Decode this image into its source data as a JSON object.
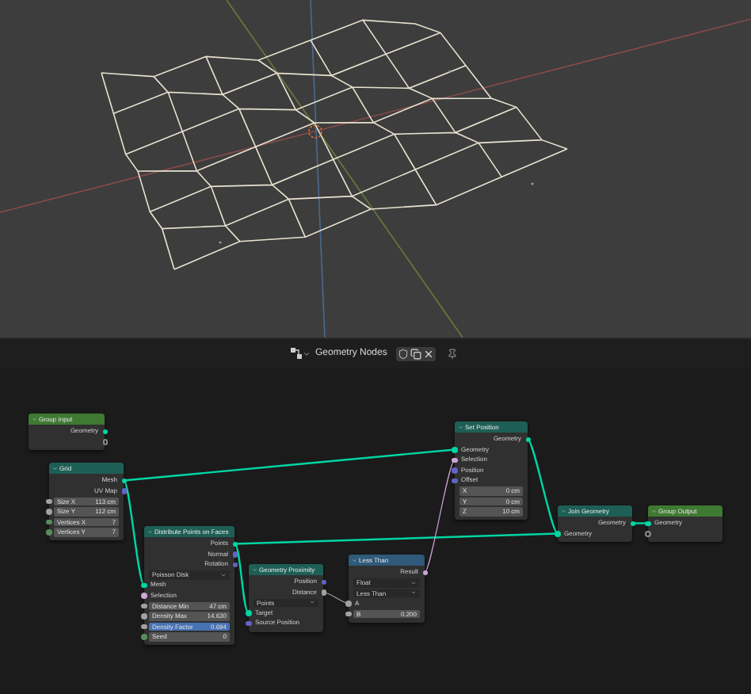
{
  "header": {
    "title": "Geometry Nodes"
  },
  "nodes": [
    {
      "title": "Group Input",
      "kind": "group",
      "rows": [
        {
          "kind": "output",
          "label": "Geometry",
          "color": "#00d6a3"
        },
        {
          "kind": "virtual"
        }
      ]
    },
    {
      "title": "Grid",
      "kind": "geometry",
      "rows": [
        {
          "kind": "output",
          "label": "Mesh",
          "color": "#00d6a3"
        },
        {
          "kind": "output",
          "label": "UV Map",
          "color": "#6363c7"
        },
        {
          "kind": "field",
          "label": "Size X",
          "value": "113 cm",
          "color": "#a1a1a1",
          "active": false
        },
        {
          "kind": "field",
          "label": "Size Y",
          "value": "112 cm",
          "color": "#a1a1a1",
          "active": false
        },
        {
          "kind": "field",
          "label": "Vertices X",
          "value": "7",
          "color": "#598c5c",
          "active": false
        },
        {
          "kind": "field",
          "label": "Vertices Y",
          "value": "7",
          "color": "#598c5c",
          "active": false
        }
      ]
    },
    {
      "title": "Distribute Points on Faces",
      "kind": "geometry",
      "rows": [
        {
          "kind": "output",
          "label": "Points",
          "color": "#00d6a3"
        },
        {
          "kind": "output",
          "label": "Normal",
          "color": "#6363c7"
        },
        {
          "kind": "output",
          "label": "Rotation",
          "color": "#6363c7"
        },
        {
          "kind": "dropdown",
          "label": "Poisson Disk"
        },
        {
          "kind": "input",
          "label": "Mesh",
          "color": "#00d6a3"
        },
        {
          "kind": "input",
          "label": "Selection",
          "color": "#cca6d6"
        },
        {
          "kind": "field",
          "label": "Distance Min",
          "value": "47 cm",
          "color": "#a1a1a1",
          "active": false
        },
        {
          "kind": "field",
          "label": "Density Max",
          "value": "14.630",
          "color": "#a1a1a1",
          "active": false
        },
        {
          "kind": "field",
          "label": "Density Factor",
          "value": "0.694",
          "color": "#a1a1a1",
          "active": true
        },
        {
          "kind": "field",
          "label": "Seed",
          "value": "0",
          "color": "#598c5c",
          "active": false
        }
      ]
    },
    {
      "title": "Geometry Proximity",
      "kind": "geometry",
      "rows": [
        {
          "kind": "output",
          "label": "Position",
          "color": "#6363c7"
        },
        {
          "kind": "output",
          "label": "Distance",
          "color": "#a1a1a1"
        },
        {
          "kind": "dropdown",
          "label": "Points"
        },
        {
          "kind": "input",
          "label": "Target",
          "color": "#00d6a3"
        },
        {
          "kind": "input",
          "label": "Source Position",
          "color": "#6363c7"
        }
      ]
    },
    {
      "title": "Less Than",
      "kind": "converter",
      "rows": [
        {
          "kind": "output",
          "label": "Result",
          "color": "#cca6d6"
        },
        {
          "kind": "dropdown",
          "label": "Float"
        },
        {
          "kind": "dropdown",
          "label": "Less Than"
        },
        {
          "kind": "input",
          "label": "A",
          "color": "#a1a1a1"
        },
        {
          "kind": "field",
          "label": "B",
          "value": "0.200",
          "color": "#a1a1a1",
          "active": false
        }
      ]
    },
    {
      "title": "Set Position",
      "kind": "geometry",
      "rows": [
        {
          "kind": "output",
          "label": "Geometry",
          "color": "#00d6a3"
        },
        {
          "kind": "input",
          "label": "Geometry",
          "color": "#00d6a3"
        },
        {
          "kind": "input",
          "label": "Selection",
          "color": "#cca6d6"
        },
        {
          "kind": "input",
          "label": "Position",
          "color": "#6363c7"
        },
        {
          "kind": "input",
          "label": "Offset",
          "color": "#6363c7"
        },
        {
          "kind": "field",
          "label": "X",
          "value": "0 cm",
          "active": false
        },
        {
          "kind": "field",
          "label": "Y",
          "value": "0 cm",
          "active": false
        },
        {
          "kind": "field",
          "label": "Z",
          "value": "10 cm",
          "active": false
        }
      ]
    },
    {
      "title": "Join Geometry",
      "kind": "geometry",
      "rows": [
        {
          "kind": "output",
          "label": "Geometry",
          "color": "#00d6a3"
        },
        {
          "kind": "input",
          "label": "Geometry",
          "color": "#00d6a3"
        }
      ]
    },
    {
      "title": "Group Output",
      "kind": "group",
      "rows": [
        {
          "kind": "input",
          "label": "Geometry",
          "color": "#00d6a3"
        },
        {
          "kind": "virtual"
        }
      ]
    }
  ]
}
